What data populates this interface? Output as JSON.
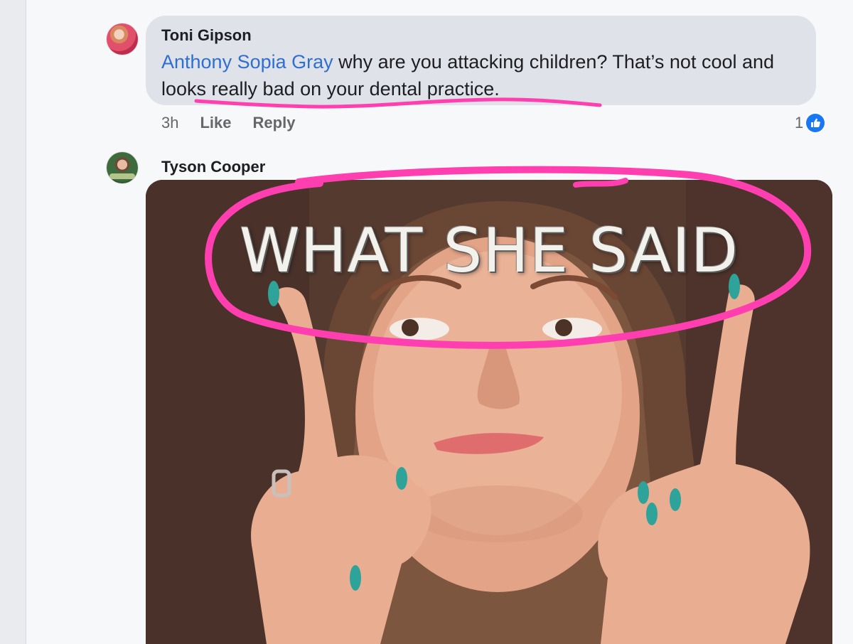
{
  "comments": [
    {
      "author": "Toni Gipson",
      "mention": "Anthony Sopia Gray",
      "text": " why are you attacking children?  That’s not cool and looks really bad on your dental practice.",
      "time": "3h",
      "like_label": "Like",
      "reply_label": "Reply",
      "reaction_count": "1",
      "reaction_icon": "thumbs-up-icon"
    },
    {
      "author": "Tyson Cooper",
      "gif_caption": "WHAT SHE SAID"
    }
  ],
  "colors": {
    "mention": "#2e6fd0",
    "bubble": "#dfe2e8",
    "annotation_pink": "#ff3fb0",
    "like_blue": "#1877f2"
  }
}
